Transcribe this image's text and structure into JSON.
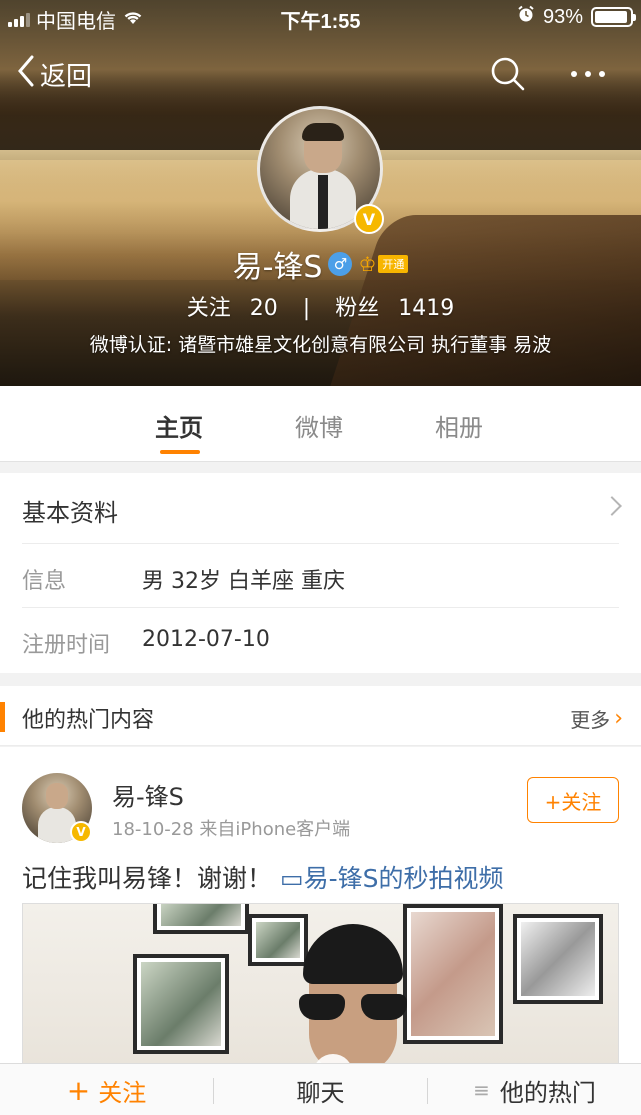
{
  "status_bar": {
    "carrier": "中国电信",
    "time": "下午1:55",
    "battery": "93%",
    "battery_level": 0.93
  },
  "nav": {
    "back_label": "返回"
  },
  "profile": {
    "name": "易-锋S",
    "gender_symbol": "♂",
    "vip_tag": "开通",
    "verified_badge": "V",
    "following_label": "关注",
    "following_count": "20",
    "divider": "|",
    "followers_label": "粉丝",
    "followers_count": "1419",
    "verification": "微博认证: 诸暨市雄星文化创意有限公司 执行董事 易波"
  },
  "tabs": [
    {
      "label": "主页",
      "active": true
    },
    {
      "label": "微博",
      "active": false
    },
    {
      "label": "相册",
      "active": false
    }
  ],
  "basic_info": {
    "title": "基本资料",
    "rows": [
      {
        "label": "信息",
        "value": "男  32岁  白羊座  重庆"
      },
      {
        "label": "注册时间",
        "value": "2012-07-10"
      }
    ]
  },
  "hot": {
    "title": "他的热门内容",
    "more_label": "更多",
    "more_arrow": "›"
  },
  "post": {
    "author": "易-锋S",
    "meta": "18-10-28  来自iPhone客户端",
    "follow_label": "+关注",
    "text": "记住我叫易锋！谢谢！",
    "link_icon": "▭",
    "link_text": "易-锋S的秒拍视频"
  },
  "bottom_bar": {
    "follow_plus": "+",
    "follow_label": "关注",
    "chat_label": "聊天",
    "menu_icon": "≡",
    "hot_label": "他的热门"
  },
  "colors": {
    "accent": "#ff8200",
    "link": "#3e6ea8",
    "verified": "#f6b800",
    "gender": "#4c9fe8"
  }
}
